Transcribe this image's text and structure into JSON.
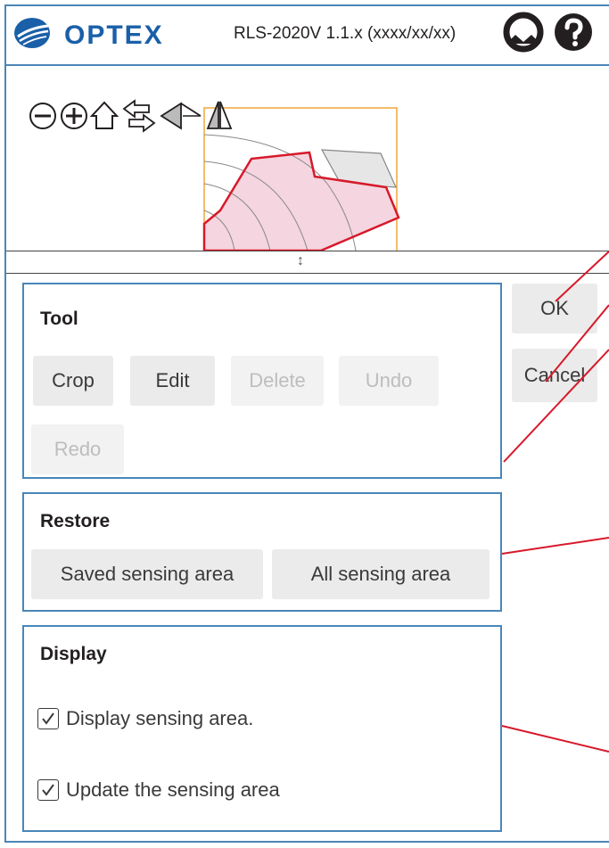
{
  "header": {
    "logo_text": "OPTEX",
    "version": "RLS-2020V 1.1.x (xxxx/xx/xx)",
    "icons": [
      "profile-icon",
      "help-icon"
    ]
  },
  "viewer": {
    "toolbar_icons": [
      "zoom-out-icon",
      "zoom-in-icon",
      "home-icon",
      "swap-icon",
      "flip-horizontal-icon",
      "flip-vertical-icon"
    ],
    "resize_glyph": "↕"
  },
  "actions": {
    "ok_label": "OK",
    "cancel_label": "Cancel"
  },
  "tool": {
    "title": "Tool",
    "buttons": [
      {
        "label": "Crop",
        "enabled": true
      },
      {
        "label": "Edit",
        "enabled": true
      },
      {
        "label": "Delete",
        "enabled": false
      },
      {
        "label": "Undo",
        "enabled": false
      },
      {
        "label": "Redo",
        "enabled": false
      }
    ]
  },
  "restore": {
    "title": "Restore",
    "buttons": [
      {
        "label": "Saved sensing area"
      },
      {
        "label": "All sensing area"
      }
    ]
  },
  "display": {
    "title": "Display",
    "options": [
      {
        "label": "Display sensing area.",
        "checked": true
      },
      {
        "label": "Update the sensing area",
        "checked": true
      }
    ]
  },
  "colors": {
    "frame_border": "#4a86b8",
    "logo_blue": "#1a5fa8",
    "callout_red": "#d7192a",
    "area_fill": "#f5d5df",
    "area_stroke": "#d7192a",
    "crop_rect": "#f0a63a"
  }
}
